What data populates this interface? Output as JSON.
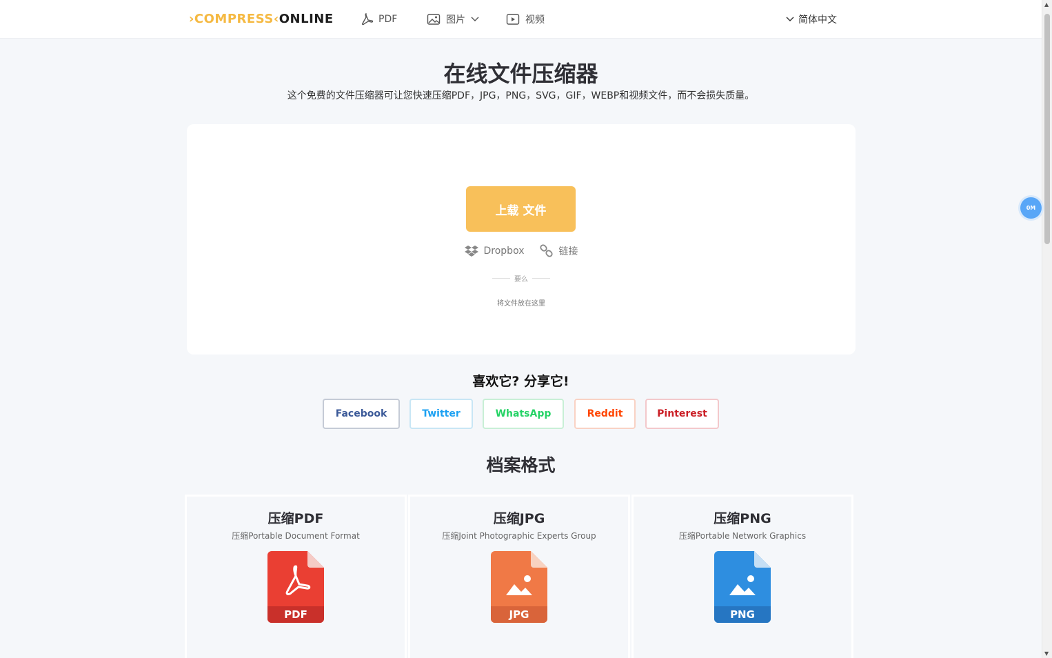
{
  "header": {
    "logo_part1": "COMPRESS",
    "logo_part2": "ONLINE",
    "nav": [
      {
        "label": "PDF",
        "icon": "pdf-icon"
      },
      {
        "label": "图片",
        "icon": "image-icon"
      },
      {
        "label": "视频",
        "icon": "video-icon"
      }
    ],
    "language": "简体中文"
  },
  "hero": {
    "title": "在线文件压缩器",
    "subtitle": "这个免费的文件压缩器可让您快速压缩PDF，JPG，PNG，SVG，GIF，WEBP和视频文件，而不会损失质量。"
  },
  "upload": {
    "button_label": "上载 文件",
    "dropbox_label": "Dropbox",
    "link_label": "链接",
    "or_label": "要么",
    "drop_text": "将文件放在这里"
  },
  "share": {
    "title": "喜欢它?  分享它!",
    "buttons": [
      {
        "label": "Facebook",
        "color": "#3b5998",
        "border": "#c5cbd6"
      },
      {
        "label": "Twitter",
        "color": "#1da1f2",
        "border": "#c8e6f5"
      },
      {
        "label": "WhatsApp",
        "color": "#25d366",
        "border": "#c8efd6"
      },
      {
        "label": "Reddit",
        "color": "#ff4500",
        "border": "#f9d2c4"
      },
      {
        "label": "Pinterest",
        "color": "#cb2027",
        "border": "#f3c8cb"
      }
    ]
  },
  "formats": {
    "title": "档案格式",
    "cards": [
      {
        "title": "压缩PDF",
        "subtitle": "压缩Portable Document Format",
        "badge": "PDF",
        "color": "#ea3f33"
      },
      {
        "title": "压缩JPG",
        "subtitle": "压缩Joint Photographic Experts Group",
        "badge": "JPG",
        "color": "#f07946"
      },
      {
        "title": "压缩PNG",
        "subtitle": "压缩Portable Network Graphics",
        "badge": "PNG",
        "color": "#2e8ee0"
      }
    ]
  },
  "floating_badge": "0M"
}
